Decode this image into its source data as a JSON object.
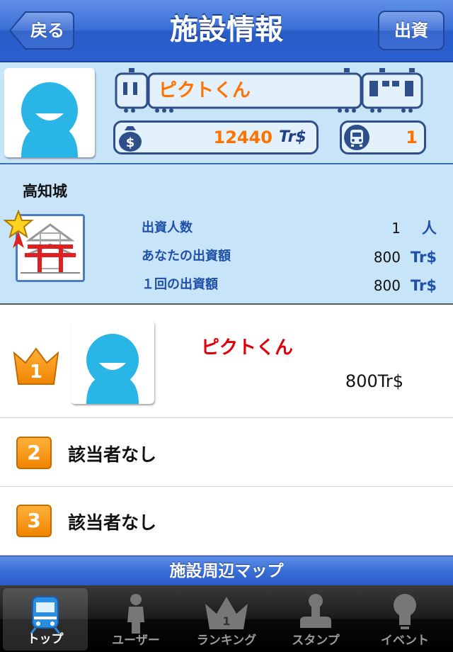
{
  "navbar": {
    "title": "施設情報",
    "back_label": "戻る",
    "invest_label": "出資"
  },
  "profile": {
    "name": "ピクトくん",
    "money": "12440",
    "money_unit": "Tr$",
    "train_count": "1"
  },
  "facility": {
    "name": "高知城",
    "stats": [
      {
        "label": "出資人数",
        "value": "1",
        "unit": "人"
      },
      {
        "label": "あなたの出資額",
        "value": "800",
        "unit": "Tr$"
      },
      {
        "label": "１回の出資額",
        "value": "800",
        "unit": "Tr$"
      }
    ]
  },
  "ranking": [
    {
      "rank": "1",
      "name": "ピクトくん",
      "amount": "800Tr$"
    },
    {
      "rank": "2",
      "name": "該当者なし"
    },
    {
      "rank": "3",
      "name": "該当者なし"
    }
  ],
  "map_banner": "施設周辺マップ",
  "tabs": [
    {
      "label": "トップ",
      "icon": "train-icon"
    },
    {
      "label": "ユーザー",
      "icon": "person-icon"
    },
    {
      "label": "ランキング",
      "icon": "crown-icon"
    },
    {
      "label": "スタンプ",
      "icon": "stamp-icon"
    },
    {
      "label": "イベント",
      "icon": "bulb-icon"
    }
  ],
  "colors": {
    "nav_blue": "#3a6fd6",
    "accent_orange": "#ff7200",
    "panel_blue": "#c8e4f8",
    "rank_red": "#e0000a"
  }
}
